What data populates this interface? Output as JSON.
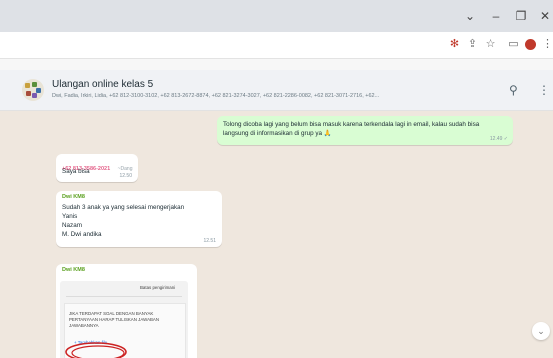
{
  "window": {
    "minimize_icon": "chevron-down-icon",
    "controls": [
      "–",
      "❐",
      "✕"
    ]
  },
  "toolbar": {
    "icons": [
      "extension-icon",
      "share-icon",
      "star-icon",
      "sidebar-icon",
      "profile-avatar",
      "menu-icon"
    ]
  },
  "chat": {
    "title": "Ulangan online kelas 5",
    "participants": "Dwi, Fadia, Irkiri, Lidia, +62 812-3100-3102, +62 813-2672-8874, +62 821-3274-3027, +62 821-2286-0082, +62 821-3071-2716, +62...",
    "search_icon": "search-icon",
    "menu_icon": "menu-icon"
  },
  "messages": [
    {
      "direction": "out",
      "text": "Tolong dicoba lagi yang belum bisa masuk karena terkendala lagi in email, kalau sudah bisa langsung di informasikan di grup ya 🙏",
      "time": "12.49 ✓"
    },
    {
      "direction": "in",
      "sender": "+62 813-3586-2021",
      "sender_name": "~Dang",
      "text": "Saya bisa",
      "time": "12.50"
    },
    {
      "direction": "in",
      "sender": "Dwi KM8",
      "lines": [
        "Sudah 3 anak ya yang selesai mengerjakan",
        "Yanis",
        "Nazam",
        "M. Dwi andika"
      ],
      "time": "12.51"
    },
    {
      "direction": "in",
      "sender": "Dwi KM8",
      "doc_header": "Batas pengirimani",
      "doc_lines": [
        "JIKA TERDAPAT SOAL DENGAN BANYAK",
        "PERTANYAAN HARAP TULISKAN JAWABAN",
        "JAWABANNYA"
      ],
      "doc_link": "+ Tambahkan file"
    }
  ],
  "colors": {
    "sender_phone": "#e4628a",
    "sender_dwi": "#5aa01e",
    "outgoing_bubble": "#d9fdd3",
    "chat_background": "#efe7de",
    "circle_annotation": "#cc2222"
  }
}
